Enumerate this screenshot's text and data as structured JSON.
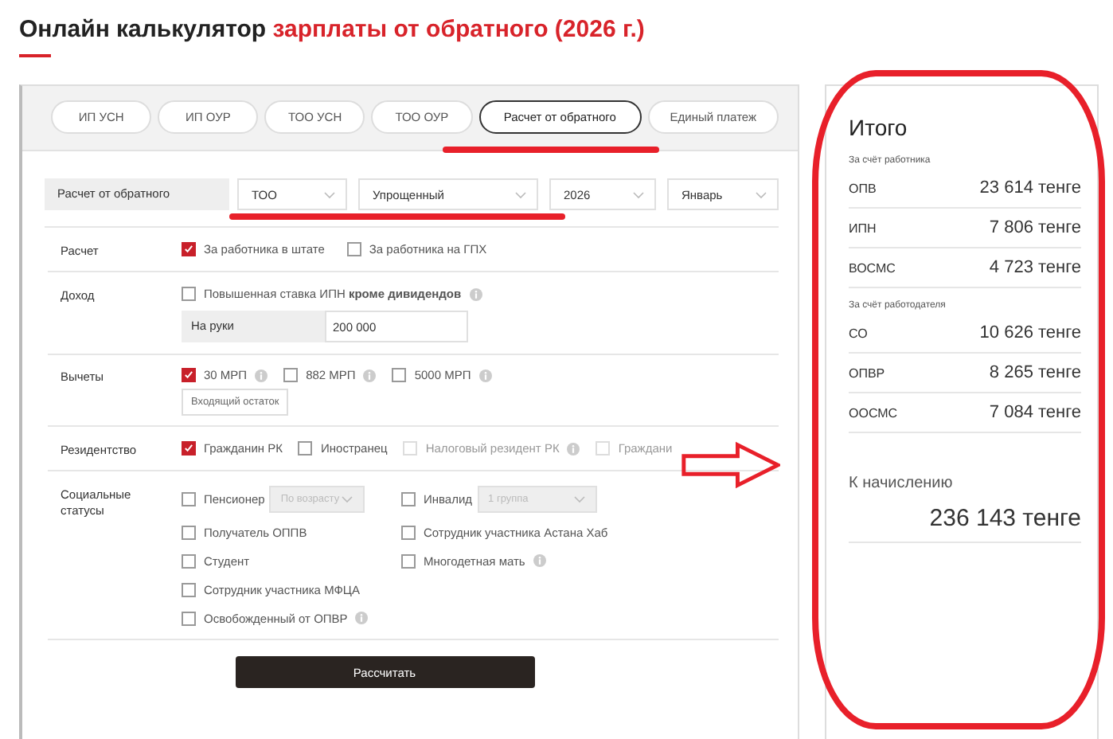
{
  "title": {
    "text": "Онлайн калькулятор",
    "highlight": "зарплаты от обратного (2026 г.)"
  },
  "tabs": [
    {
      "label": "ИП УСН",
      "selected": false
    },
    {
      "label": "ИП ОУР",
      "selected": false
    },
    {
      "label": "ТОО УСН",
      "selected": false
    },
    {
      "label": "ТОО ОУР",
      "selected": false
    },
    {
      "label": "Расчет от обратного",
      "selected": true
    },
    {
      "label": "Единый платеж",
      "selected": false
    }
  ],
  "params": {
    "label": "Расчет от обратного",
    "selects": [
      "ТОО",
      "Упрощенный",
      "2026",
      "Январь"
    ]
  },
  "sections": [
    {
      "label": "Расчет",
      "lines": [
        [
          {
            "kind": "checkbox",
            "label": "За работника в штате",
            "checked": true,
            "disabled": false
          },
          {
            "kind": "checkbox",
            "label": "За работника на ГПХ",
            "checked": false,
            "disabled": false
          }
        ]
      ]
    },
    {
      "label": "Доход",
      "lines": [
        [
          {
            "kind": "checkbox",
            "label": "Повышенная ставка ИПН **кроме дивидендов**",
            "checked": false,
            "disabled": false,
            "info": true
          }
        ],
        [
          {
            "kind": "amount",
            "label": "На руки",
            "value": "200 000"
          }
        ]
      ]
    },
    {
      "label": "Вычеты",
      "lines": [
        [
          {
            "kind": "checkbox",
            "label": "30 МРП",
            "checked": true,
            "disabled": false,
            "info": true
          },
          {
            "kind": "checkbox",
            "label": "882 МРП",
            "checked": false,
            "disabled": false,
            "info": true
          },
          {
            "kind": "checkbox",
            "label": "5000 МРП",
            "checked": false,
            "disabled": false,
            "info": true
          }
        ],
        [
          {
            "kind": "button",
            "label": "Входящий остаток"
          }
        ]
      ]
    },
    {
      "label": "Резидентство",
      "lines": [
        [
          {
            "kind": "checkbox",
            "label": "Гражданин РК",
            "checked": true,
            "disabled": false
          },
          {
            "kind": "checkbox",
            "label": "Иностранец",
            "checked": false,
            "disabled": false
          },
          {
            "kind": "checkbox",
            "label": "Налоговый резидент РК",
            "checked": false,
            "disabled": true,
            "info": true
          },
          {
            "kind": "checkbox",
            "label": "Граждани",
            "checked": false,
            "disabled": true
          }
        ]
      ]
    },
    {
      "label": "Социальные статусы",
      "columns": [
        [
          {
            "kind": "checkbox",
            "label": "Пенсионер",
            "checked": false,
            "disabled": false,
            "select": "По возрасту"
          },
          {
            "kind": "checkbox",
            "label": "Получатель ОППВ",
            "checked": false,
            "disabled": false
          },
          {
            "kind": "checkbox",
            "label": "Студент",
            "checked": false,
            "disabled": false
          },
          {
            "kind": "checkbox",
            "label": "Сотрудник участника МФЦА",
            "checked": false,
            "disabled": false
          },
          {
            "kind": "checkbox",
            "label": "Освобожденный от ОПВР",
            "checked": false,
            "disabled": false,
            "info": true
          }
        ],
        [
          {
            "kind": "checkbox",
            "label": "Инвалид",
            "checked": false,
            "disabled": false,
            "select": "1 группа"
          },
          {
            "kind": "checkbox",
            "label": "Сотрудник участника Астана Хаб",
            "checked": false,
            "disabled": false
          },
          {
            "kind": "checkbox",
            "label": "Многодетная мать",
            "checked": false,
            "disabled": false,
            "info": true
          }
        ]
      ]
    }
  ],
  "submit": "Рассчитать",
  "summary": {
    "title": "Итого",
    "groups": [
      {
        "label": "За счёт работника",
        "rows": [
          {
            "name": "ОПВ",
            "value": "23 614 тенге"
          },
          {
            "name": "ИПН",
            "value": "7 806 тенге"
          },
          {
            "name": "ВОСМС",
            "value": "4 723 тенге"
          }
        ]
      },
      {
        "label": "За счёт работодателя",
        "rows": [
          {
            "name": "СО",
            "value": "10 626 тенге"
          },
          {
            "name": "ОПВР",
            "value": "8 265 тенге"
          },
          {
            "name": "ООСМС",
            "value": "7 084 тенге"
          }
        ]
      }
    ],
    "total_label": "К начислению",
    "total": "236 143 тенге"
  }
}
